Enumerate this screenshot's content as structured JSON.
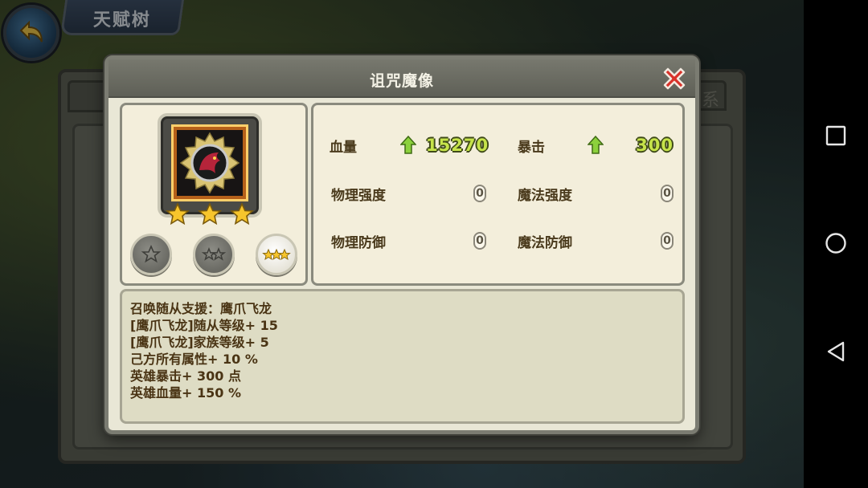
{
  "app": {
    "screen_title": "天赋树",
    "background_tab_partial": "系"
  },
  "popup": {
    "title": "诅咒魔像",
    "stats": {
      "hp_label": "血量",
      "hp_value": "15270",
      "crit_label": "暴击",
      "crit_value": "300",
      "phys_atk_label": "物理强度",
      "phys_atk_value": "0",
      "magic_atk_label": "魔法强度",
      "magic_atk_value": "0",
      "phys_def_label": "物理防御",
      "phys_def_value": "0",
      "magic_def_label": "魔法防御",
      "magic_def_value": "0"
    },
    "hero": {
      "stars": 3,
      "selected_grade": 3,
      "portrait_icon": "dragon-emblem-icon"
    },
    "description": [
      "召唤随从支援：鹰爪飞龙",
      "[鹰爪飞龙]随从等级+ 15",
      "[鹰爪飞龙]家族等级+ 5",
      "己方所有属性+ 10 %",
      "英雄暴击+ 300 点",
      "英雄血量+ 150 %"
    ]
  },
  "colors": {
    "stat_value_green": "#c6e34a",
    "up_arrow_green": "#8cd13c",
    "close_red": "#d8322a",
    "star_gold": "#f7c52c"
  },
  "nav_icons": [
    "recent-apps-icon",
    "home-icon",
    "back-icon"
  ]
}
